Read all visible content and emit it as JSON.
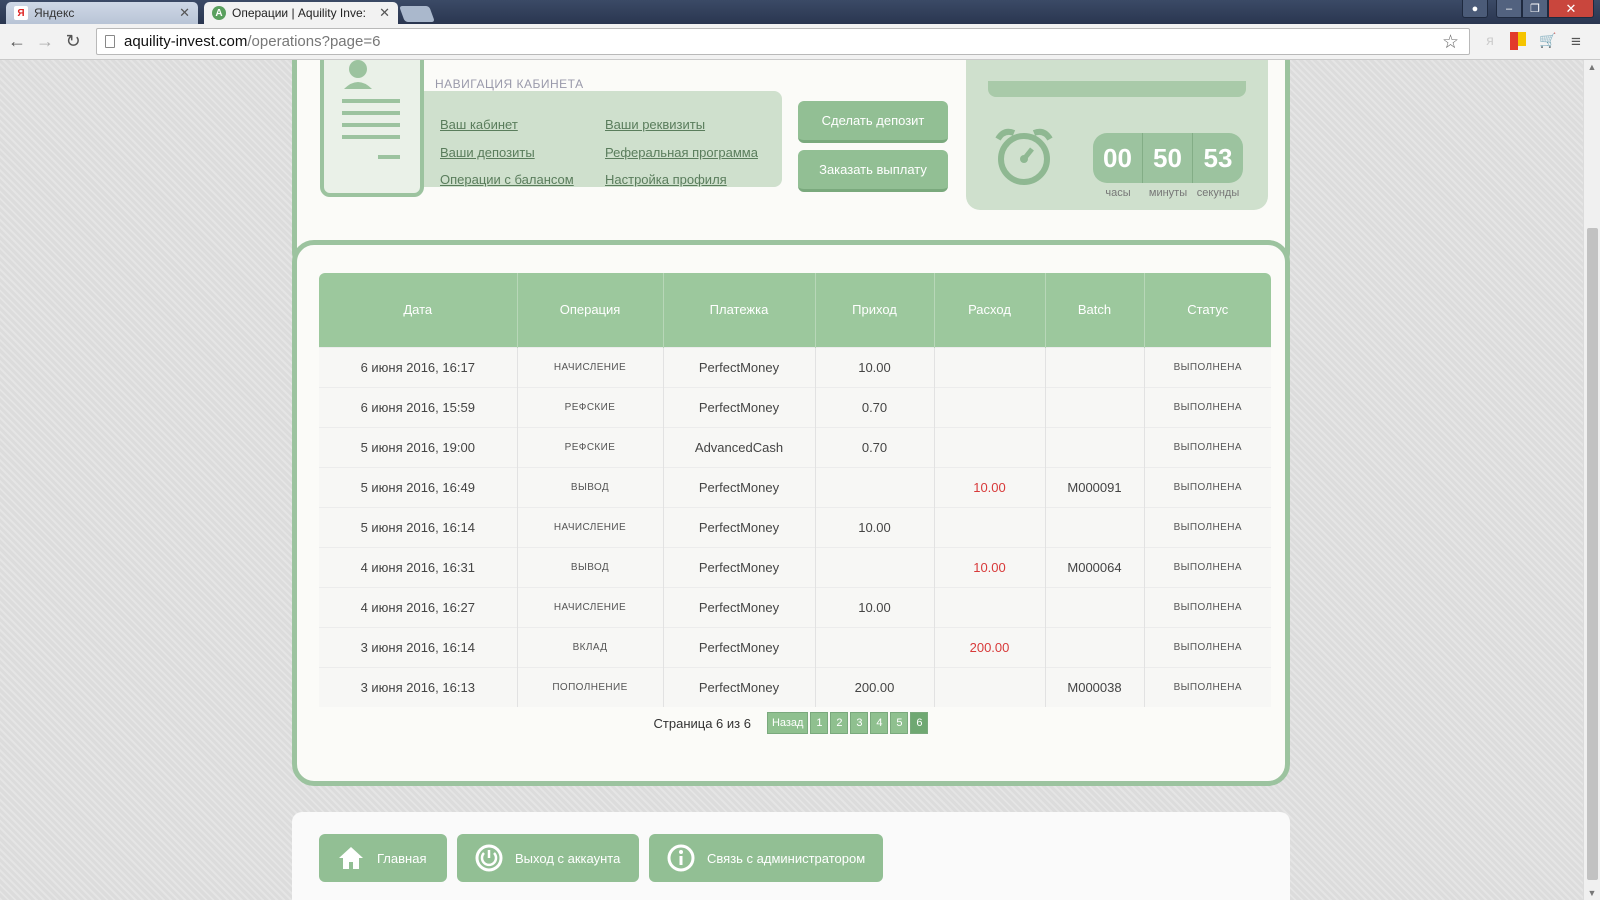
{
  "browser": {
    "tabs": [
      {
        "title": "Яндекс",
        "favicon": "Я",
        "active": false
      },
      {
        "title": "Операции | Aquility Inve:",
        "favicon": "A",
        "active": true
      }
    ],
    "url_host": "aquility-invest.com",
    "url_path": "/operations?page=6"
  },
  "cabinet": {
    "nav_title": "НАВИГАЦИЯ КАБИНЕТА",
    "links": {
      "cabinet": "Ваш кабинет",
      "deposits": "Ваши депозиты",
      "balance_ops": "Операции с балансом",
      "requisites": "Ваши реквизиты",
      "referral": "Реферальная программа",
      "profile": "Настройка профиля"
    },
    "make_deposit": "Сделать депозит",
    "order_payout": "Заказать выплату"
  },
  "timer": {
    "hours": "00",
    "minutes": "50",
    "seconds": "53",
    "hours_label": "часы",
    "minutes_label": "минуты",
    "seconds_label": "секунды"
  },
  "table": {
    "headers": [
      "Дата",
      "Операция",
      "Платежка",
      "Приход",
      "Расход",
      "Batch",
      "Статус"
    ],
    "rows": [
      {
        "date": "6 июня 2016, 16:17",
        "op": "начисление",
        "ps": "PerfectMoney",
        "in": "10.00",
        "out": "",
        "batch": "",
        "status": "выполнена"
      },
      {
        "date": "6 июня 2016, 15:59",
        "op": "рефские",
        "ps": "PerfectMoney",
        "in": "0.70",
        "out": "",
        "batch": "",
        "status": "выполнена"
      },
      {
        "date": "5 июня 2016, 19:00",
        "op": "рефские",
        "ps": "AdvancedCash",
        "in": "0.70",
        "out": "",
        "batch": "",
        "status": "выполнена"
      },
      {
        "date": "5 июня 2016, 16:49",
        "op": "вывод",
        "ps": "PerfectMoney",
        "in": "",
        "out": "10.00",
        "batch": "M000091",
        "status": "выполнена"
      },
      {
        "date": "5 июня 2016, 16:14",
        "op": "начисление",
        "ps": "PerfectMoney",
        "in": "10.00",
        "out": "",
        "batch": "",
        "status": "выполнена"
      },
      {
        "date": "4 июня 2016, 16:31",
        "op": "вывод",
        "ps": "PerfectMoney",
        "in": "",
        "out": "10.00",
        "batch": "M000064",
        "status": "выполнена"
      },
      {
        "date": "4 июня 2016, 16:27",
        "op": "начисление",
        "ps": "PerfectMoney",
        "in": "10.00",
        "out": "",
        "batch": "",
        "status": "выполнена"
      },
      {
        "date": "3 июня 2016, 16:14",
        "op": "вклад",
        "ps": "PerfectMoney",
        "in": "",
        "out": "200.00",
        "batch": "",
        "status": "выполнена"
      },
      {
        "date": "3 июня 2016, 16:13",
        "op": "пополнение",
        "ps": "PerfectMoney",
        "in": "200.00",
        "out": "",
        "batch": "M000038",
        "status": "выполнена"
      }
    ]
  },
  "pager": {
    "text": "Страница 6 из 6",
    "back": "Назад",
    "pages": [
      "1",
      "2",
      "3",
      "4",
      "5",
      "6"
    ],
    "current": "6"
  },
  "footer": {
    "home": "Главная",
    "logout": "Выход с аккаунта",
    "contact": "Связь с администратором"
  },
  "colors": {
    "accent": "#9cc39f",
    "negative": "#d83a3a"
  }
}
